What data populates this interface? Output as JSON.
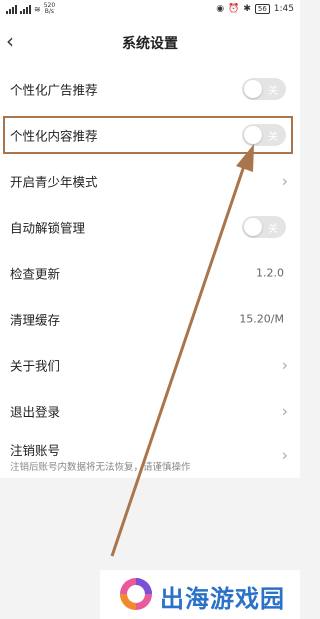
{
  "status_bar": {
    "network": "520\nB/s",
    "battery": "56",
    "time": "1:45"
  },
  "header": {
    "back_icon": "chevron-left-icon",
    "title": "系统设置"
  },
  "settings": {
    "ad_recommend": {
      "label": "个性化广告推荐",
      "toggle_text": "关",
      "on": false
    },
    "content_recommend": {
      "label": "个性化内容推荐",
      "toggle_text": "关",
      "on": false
    },
    "teen_mode": {
      "label": "开启青少年模式"
    },
    "auto_unlock": {
      "label": "自动解锁管理",
      "toggle_text": "关",
      "on": false
    },
    "check_update": {
      "label": "检查更新",
      "value": "1.2.0"
    },
    "clear_cache": {
      "label": "清理缓存",
      "value": "15.20/M"
    },
    "about": {
      "label": "关于我们"
    },
    "logout": {
      "label": "退出登录"
    },
    "cancel_account": {
      "label": "注销账号",
      "sub": "注销后账号内数据将无法恢复，请谨慎操作"
    }
  },
  "watermark": {
    "text": "出海游戏园"
  },
  "colors": {
    "annotation": "#a8754d",
    "watermark_blue": "#2a72c9",
    "toggle_off": "#e4e4e4"
  }
}
